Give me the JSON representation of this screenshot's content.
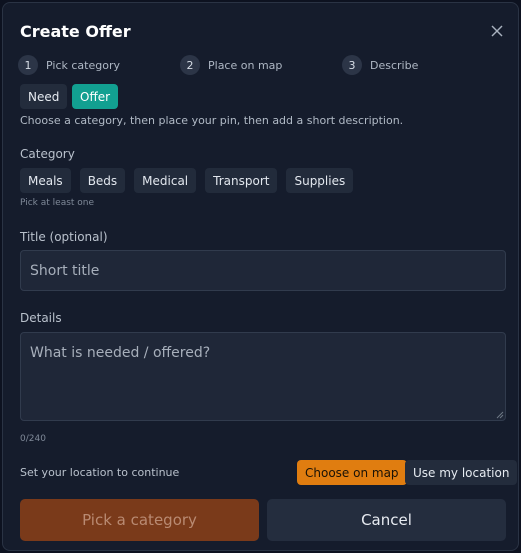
{
  "dialog": {
    "title": "Create Offer",
    "close_icon": "close-icon"
  },
  "steps": [
    {
      "number": "1",
      "label": "Pick category"
    },
    {
      "number": "2",
      "label": "Place on map"
    },
    {
      "number": "3",
      "label": "Describe"
    }
  ],
  "type_toggle": {
    "need_label": "Need",
    "offer_label": "Offer",
    "selected": "Offer"
  },
  "instruction": "Choose a category, then place your pin, then add a short description.",
  "category": {
    "label": "Category",
    "chips": [
      "Meals",
      "Beds",
      "Medical",
      "Transport",
      "Supplies"
    ],
    "hint": "Pick at least one"
  },
  "title_field": {
    "label": "Title (optional)",
    "placeholder": "Short title",
    "value": ""
  },
  "details_field": {
    "label": "Details",
    "placeholder": "What is needed / offered?",
    "value": "",
    "counter": "0/240"
  },
  "location": {
    "prompt": "Set your location to continue",
    "choose_on_map_label": "Choose on map",
    "use_my_location_label": "Use my location"
  },
  "footer": {
    "submit_label": "Pick a category",
    "cancel_label": "Cancel"
  },
  "colors": {
    "accent_teal": "#12a091",
    "accent_orange": "#e07d10",
    "submit_disabled": "#7a3a1a",
    "panel": "#151c2c"
  }
}
